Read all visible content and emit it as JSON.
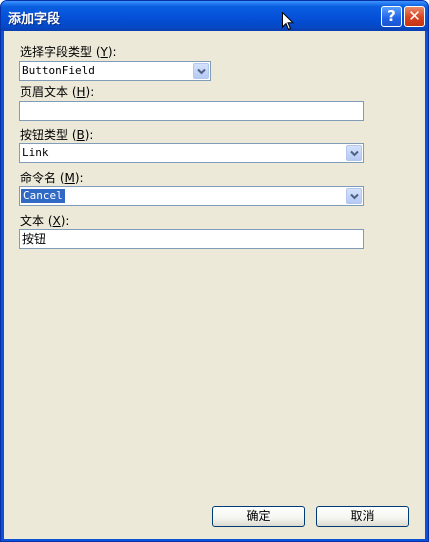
{
  "window": {
    "title": "添加字段",
    "help_glyph": "?",
    "close_glyph": "✕"
  },
  "form": {
    "field_type": {
      "label_pre": "选择字段类型 (",
      "mnemonic": "Y",
      "label_post": "):",
      "value": "ButtonField"
    },
    "header_text": {
      "label_pre": "页眉文本 (",
      "mnemonic": "H",
      "label_post": "):",
      "value": ""
    },
    "button_type": {
      "label_pre": "按钮类型 (",
      "mnemonic": "B",
      "label_post": "):",
      "value": "Link"
    },
    "command_name": {
      "label_pre": "命令名 (",
      "mnemonic": "M",
      "label_post": "):",
      "value": "Cancel"
    },
    "text": {
      "label_pre": "文本 (",
      "mnemonic": "X",
      "label_post": "):",
      "value": "按钮"
    }
  },
  "buttons": {
    "ok": "确定",
    "cancel": "取消"
  },
  "colors": {
    "titlebar": "#0550d8",
    "client": "#ece9d8",
    "selection": "#316ac5",
    "input_border": "#7f9db9"
  }
}
